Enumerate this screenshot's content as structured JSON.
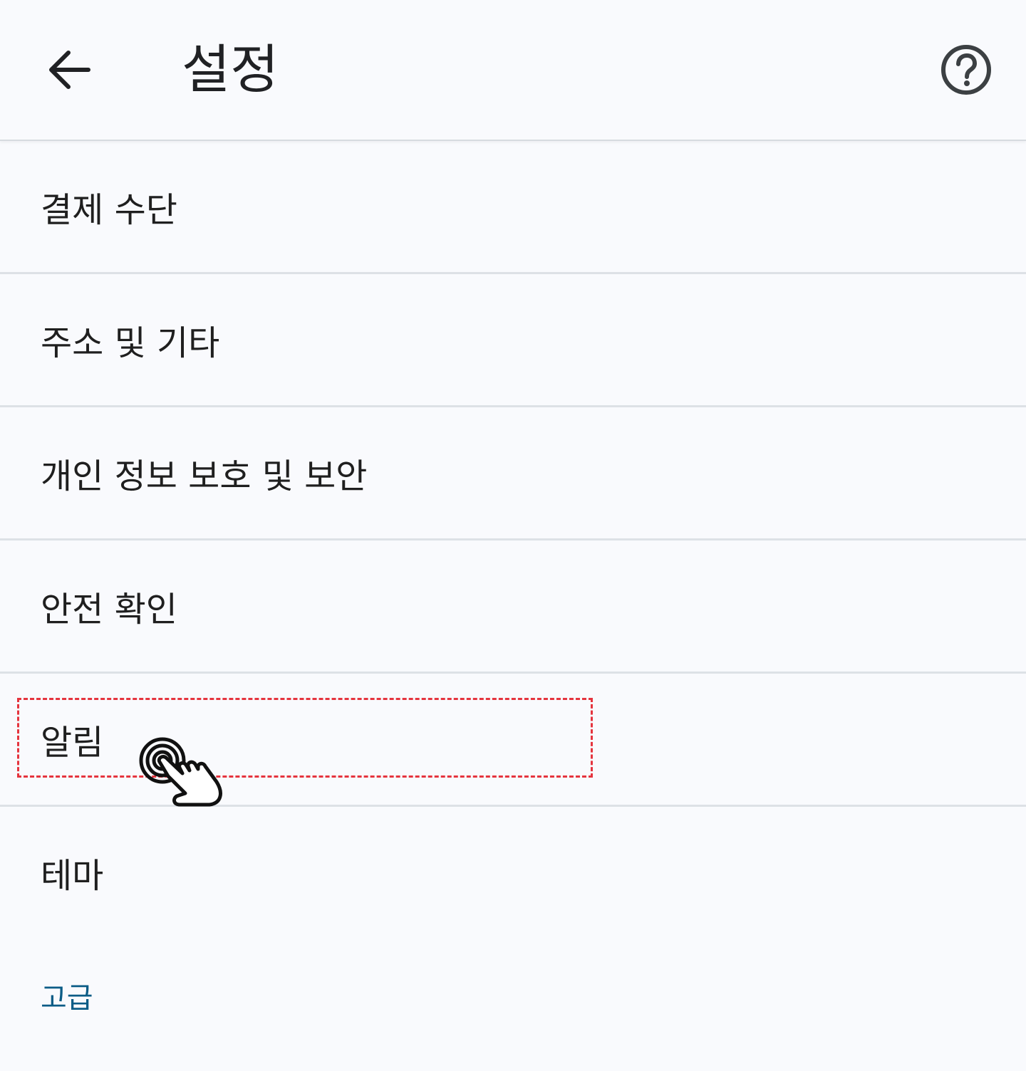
{
  "header": {
    "title": "설정",
    "back_icon": "arrow-back-icon",
    "help_icon": "help-circle-icon"
  },
  "settings": {
    "items": [
      {
        "label": "결제 수단"
      },
      {
        "label": "주소 및 기타"
      },
      {
        "label": "개인 정보 보호 및 보안"
      },
      {
        "label": "안전 확인"
      },
      {
        "label": "알림"
      },
      {
        "label": "테마"
      }
    ]
  },
  "advanced_section": {
    "label": "고급"
  },
  "annotation": {
    "highlight_color": "#e5343e",
    "cursor_icon": "tap-hand-icon"
  },
  "colors": {
    "section_header": "#0b5c86",
    "background": "#f9fafd",
    "divider": "#dde1e6"
  }
}
